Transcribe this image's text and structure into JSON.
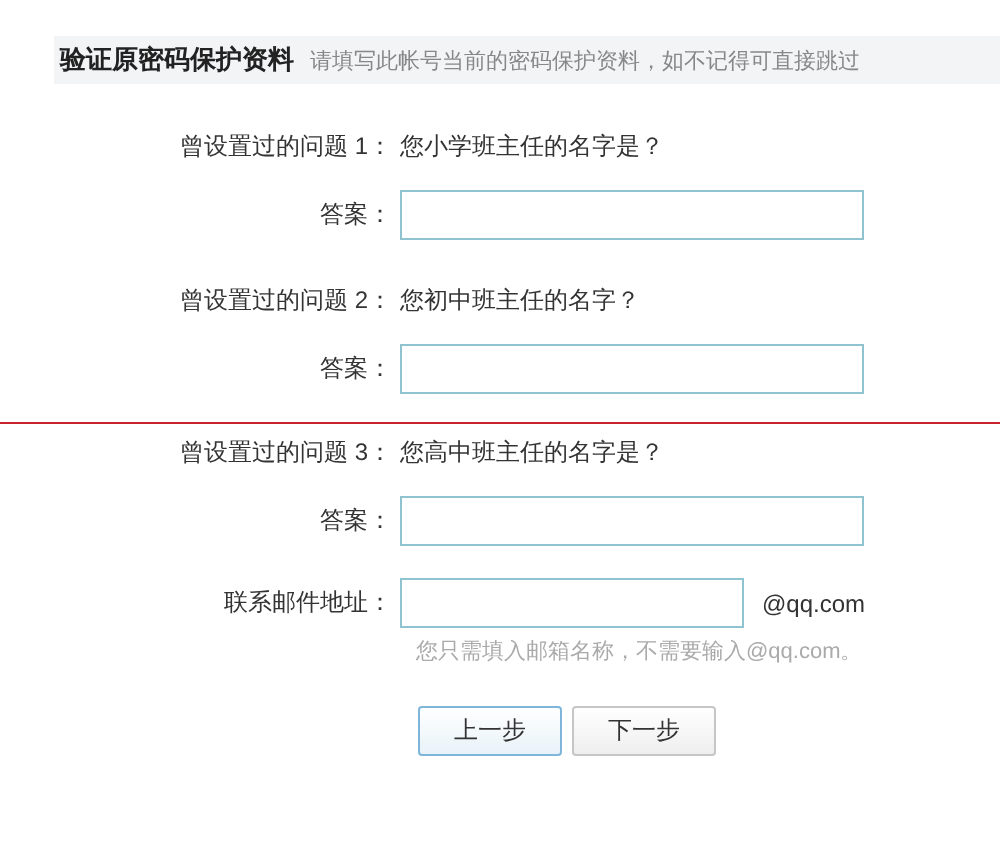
{
  "header": {
    "title": "验证原密码保护资料",
    "hint": "请填写此帐号当前的密码保护资料，如不记得可直接跳过"
  },
  "questions": [
    {
      "label": "曾设置过的问题 1：",
      "question": "您小学班主任的名字是？",
      "answer_label": "答案：",
      "divider_before": false
    },
    {
      "label": "曾设置过的问题 2：",
      "question": "您初中班主任的名字？",
      "answer_label": "答案：",
      "divider_before": false
    },
    {
      "label": "曾设置过的问题 3：",
      "question": "您高中班主任的名字是？",
      "answer_label": "答案：",
      "divider_before": true
    }
  ],
  "email": {
    "label": "联系邮件地址：",
    "suffix": "@qq.com",
    "hint": "您只需填入邮箱名称，不需要输入@qq.com。"
  },
  "buttons": [
    {
      "label": "上一步",
      "focused": true
    },
    {
      "label": "下一步",
      "focused": false
    }
  ]
}
